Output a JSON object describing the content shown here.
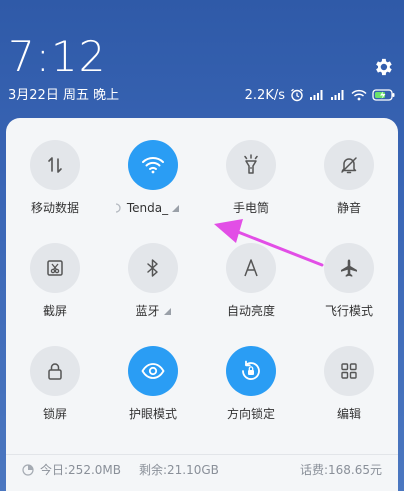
{
  "status": {
    "time": "7:12",
    "date": "3月22日 周五 晚上",
    "speed": "2.2K/s"
  },
  "tiles": [
    {
      "label": "移动数据",
      "icon": "mobile-data-icon",
      "on": false
    },
    {
      "label": "Tenda_",
      "icon": "wifi-icon",
      "on": true
    },
    {
      "label": "手电筒",
      "icon": "flashlight-icon",
      "on": false
    },
    {
      "label": "静音",
      "icon": "mute-bell-icon",
      "on": false
    },
    {
      "label": "截屏",
      "icon": "screenshot-icon",
      "on": false
    },
    {
      "label": "蓝牙",
      "icon": "bluetooth-icon",
      "on": false
    },
    {
      "label": "自动亮度",
      "icon": "auto-brightness-icon",
      "on": false
    },
    {
      "label": "飞行模式",
      "icon": "airplane-icon",
      "on": false
    },
    {
      "label": "锁屏",
      "icon": "lock-icon",
      "on": false
    },
    {
      "label": "护眼模式",
      "icon": "eye-icon",
      "on": true
    },
    {
      "label": "方向锁定",
      "icon": "rotation-lock-icon",
      "on": true
    },
    {
      "label": "编辑",
      "icon": "edit-grid-icon",
      "on": false
    }
  ],
  "footer": {
    "today": "今日:252.0MB",
    "remaining": "剩余:21.10GB",
    "balance": "话费:168.65元"
  },
  "colors": {
    "accent": "#2a9df4",
    "arrow": "#e24ee6"
  }
}
